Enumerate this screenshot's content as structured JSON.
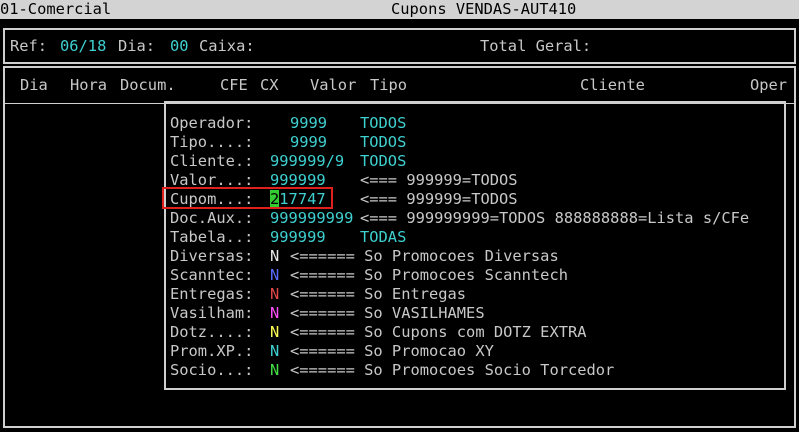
{
  "window": {
    "company": "01-Comercial",
    "title": "Cupons VENDAS-AUT410"
  },
  "header": {
    "ref_label": "Ref:",
    "ref_value": "06/18",
    "dia_label": "Dia:",
    "dia_value": "00",
    "caixa_label": "Caixa:",
    "total_label": "Total Geral:"
  },
  "columns": [
    "Dia",
    "Hora",
    "Docum.",
    "CFE",
    "CX",
    "Valor",
    "Tipo",
    "Cliente",
    "Oper"
  ],
  "filters": [
    {
      "label": "Operador:",
      "value": "9999",
      "desc": "TODOS"
    },
    {
      "label": "Tipo....:",
      "value": "9999",
      "desc": "TODOS"
    },
    {
      "label": "Cliente.:",
      "value": "999999/9",
      "desc": "TODOS"
    },
    {
      "label": "Valor...:",
      "value": "999999",
      "desc": "<=== 999999=TODOS"
    },
    {
      "label": "Cupom...:",
      "value_cursor": "2",
      "value_rest": "17747",
      "desc": "<=== 999999=TODOS"
    },
    {
      "label": "Doc.Aux.:",
      "value": "999999999",
      "desc": "<=== 999999999=TODOS 888888888=Lista s/CFe"
    },
    {
      "label": "Tabela..:",
      "value": "999999",
      "desc": "TODAS"
    }
  ],
  "options": [
    {
      "label": "Diversas:",
      "flag": "N",
      "color": "#e8e8e8",
      "desc": "<====== So Promocoes Diversas"
    },
    {
      "label": "Scanntec:",
      "flag": "N",
      "color": "#5a6bff",
      "desc": "<====== So Promocoes Scanntech"
    },
    {
      "label": "Entregas:",
      "flag": "N",
      "color": "#e04848",
      "desc": "<====== So Entregas"
    },
    {
      "label": "Vasilham:",
      "flag": "N",
      "color": "#ff4fff",
      "desc": "<====== So VASILHAMES"
    },
    {
      "label": "Dotz....:",
      "flag": "N",
      "color": "#ffff55",
      "desc": "<====== So Cupons com DOTZ EXTRA"
    },
    {
      "label": "Prom.XP.:",
      "flag": "N",
      "color": "#3fd0d0",
      "desc": "<====== So Promocao XY"
    },
    {
      "label": "Socio...:",
      "flag": "N",
      "color": "#44e044",
      "desc": "<====== So Promocoes Socio Torcedor"
    }
  ]
}
